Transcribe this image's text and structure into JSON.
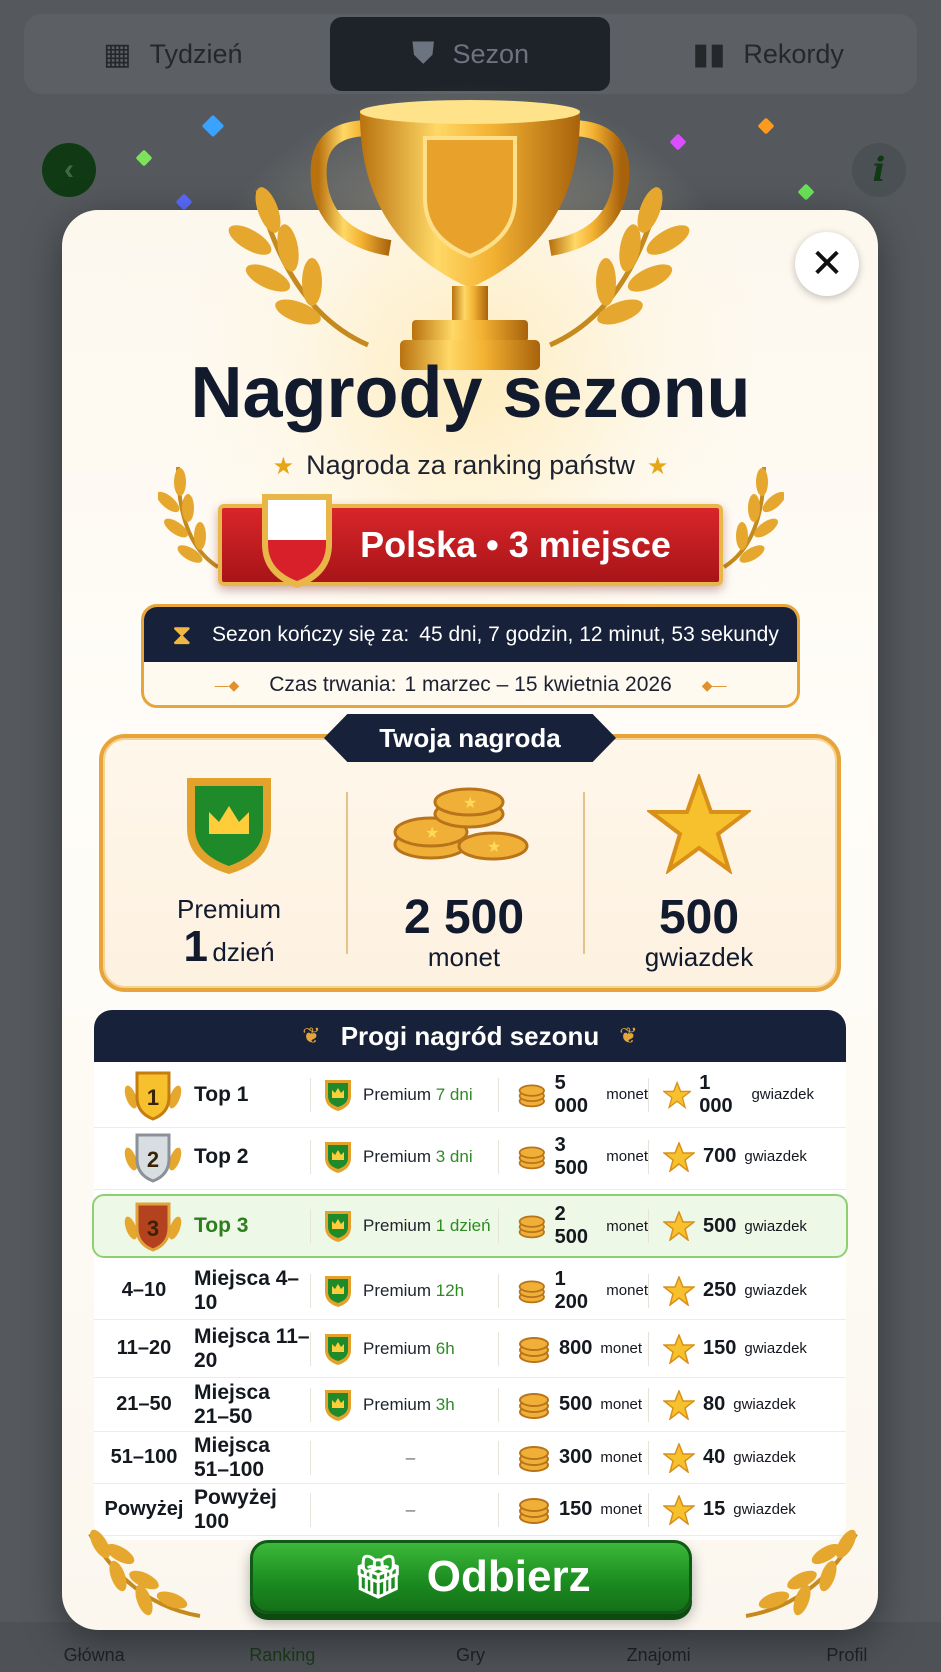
{
  "background": {
    "tabs": [
      {
        "label": "Tydzień",
        "icon": "calendar-icon"
      },
      {
        "label": "Sezon",
        "icon": "shield-star-icon"
      },
      {
        "label": "Rekordy",
        "icon": "bar-chart-icon"
      }
    ],
    "back_icon": "‹",
    "info_icon": "i",
    "nav": [
      "Główna",
      "Ranking",
      "Gry",
      "Znajomi",
      "Profil"
    ]
  },
  "modal": {
    "close_icon": "✕",
    "title": "Nagrody sezonu",
    "subtitle": "Nagroda za ranking państw",
    "country_rank": "Polska • 3 miejsce",
    "season_ends_label": "Sezon kończy się za:",
    "season_ends_value": "45 dni, 7 godzin, 12 minut, 53 sekundy",
    "duration_label": "Czas trwania:",
    "duration_value": "1 marzec – 15 kwietnia 2026",
    "your_reward_label": "Twoja nagroda",
    "reward": {
      "premium_label": "Premium",
      "premium_amount": "1",
      "premium_unit": "dzień",
      "coins_value": "2 500",
      "coins_unit": "monet",
      "stars_value": "500",
      "stars_unit": "gwiazdek"
    },
    "tiers_title": "Progi nagród sezonu",
    "tiers": [
      {
        "rank": "1",
        "label": "Top 1",
        "premium": "Premium",
        "premium_time": "7 dni",
        "coins": "5 000",
        "coins_unit": "monet",
        "stars": "1 000",
        "stars_unit": "gwiazdek"
      },
      {
        "rank": "2",
        "label": "Top 2",
        "premium": "Premium",
        "premium_time": "3 dni",
        "coins": "3 500",
        "coins_unit": "monet",
        "stars": "700",
        "stars_unit": "gwiazdek"
      },
      {
        "rank": "3",
        "label": "Top 3",
        "premium": "Premium",
        "premium_time": "1 dzień",
        "coins": "2 500",
        "coins_unit": "monet",
        "stars": "500",
        "stars_unit": "gwiazdek"
      },
      {
        "rank": "4–10",
        "label": "Miejsca 4–10",
        "premium": "Premium",
        "premium_time": "12h",
        "coins": "1 200",
        "coins_unit": "monet",
        "stars": "250",
        "stars_unit": "gwiazdek"
      },
      {
        "rank": "11–20",
        "label": "Miejsca 11–20",
        "premium": "Premium",
        "premium_time": "6h",
        "coins": "800",
        "coins_unit": "monet",
        "stars": "150",
        "stars_unit": "gwiazdek"
      },
      {
        "rank": "21–50",
        "label": "Miejsca 21–50",
        "premium": "Premium",
        "premium_time": "3h",
        "coins": "500",
        "coins_unit": "monet",
        "stars": "80",
        "stars_unit": "gwiazdek"
      },
      {
        "rank": "51–100",
        "label": "Miejsca 51–100",
        "premium_dash": "–",
        "coins": "300",
        "coins_unit": "monet",
        "stars": "40",
        "stars_unit": "gwiazdek"
      },
      {
        "rank": "Powyżej",
        "label": "Powyżej 100",
        "premium_dash": "–",
        "coins": "150",
        "coins_unit": "monet",
        "stars": "15",
        "stars_unit": "gwiazdek"
      }
    ],
    "claim_button": "Odbierz",
    "colors": {
      "navy": "#17213a",
      "gold": "#e8a43a",
      "red": "#c41c20",
      "green": "#1a8a1f",
      "highlight_row": "#eef8e6"
    }
  }
}
